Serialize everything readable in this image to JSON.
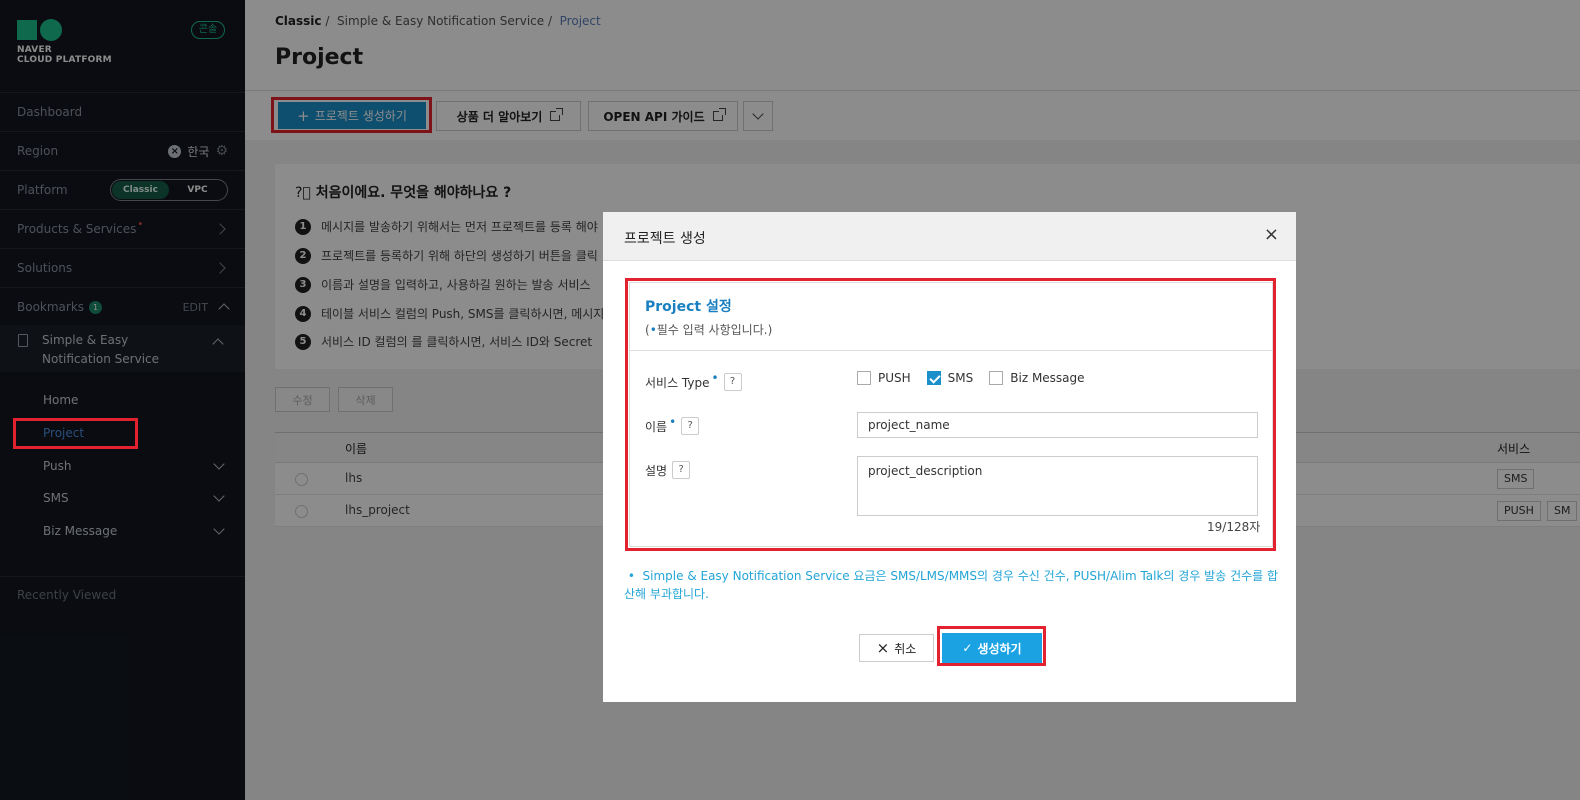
{
  "sidebar": {
    "logo_line1": "NAVER",
    "logo_line2": "CLOUD PLATFORM",
    "lang_badge": "콘솔",
    "dashboard": "Dashboard",
    "region_label": "Region",
    "region_value": "한국",
    "platform_label": "Platform",
    "platform_options": [
      "Classic",
      "VPC"
    ],
    "products": "Products & Services",
    "solutions": "Solutions",
    "bookmarks": "Bookmarks",
    "bookmarks_count": "1",
    "edit": "EDIT",
    "service_name": "Simple & Easy Notification Service",
    "sub_items": [
      "Home",
      "Project",
      "Push",
      "SMS",
      "Biz Message"
    ],
    "recently_viewed": "Recently Viewed"
  },
  "breadcrumb": {
    "root": "Classic",
    "service": "Simple & Easy Notification Service",
    "current": "Project",
    "sep": "/"
  },
  "page_title": "Project",
  "toolbar": {
    "create": "프로젝트 생성하기",
    "learn_more": "상품 더 알아보기",
    "api_guide": "OPEN API 가이드"
  },
  "guide": {
    "title": "처음이에요. 무엇을 해야하나요 ?",
    "steps": [
      "메시지를 발송하기 위해서는 먼저 프로젝트를 등록 해야",
      "프로젝트를 등록하기 위해 하단의 생성하기 버튼을 클릭",
      "이름과 설명을 입력하고, 사용하길 원하는 발송 서비스",
      "테이블 서비스 컬럼의 Push, SMS를 클릭하시면, 메시지",
      "서비스 ID 컬럼의 를 클릭하시면, 서비스 ID와 Secret"
    ]
  },
  "actions": {
    "edit": "수정",
    "delete": "삭제"
  },
  "table": {
    "headers": {
      "name": "이름",
      "service": "서비스"
    },
    "rows": [
      {
        "name": "lhs",
        "services": [
          "SMS"
        ]
      },
      {
        "name": "lhs_project",
        "services": [
          "PUSH",
          "SM"
        ]
      }
    ]
  },
  "modal": {
    "title": "프로젝트 생성",
    "close": "×",
    "section_title": "Project 설정",
    "required_note": "필수 입력 사항입니다.",
    "service_type_label": "서비스 Type",
    "service_types": [
      {
        "label": "PUSH",
        "checked": false
      },
      {
        "label": "SMS",
        "checked": true
      },
      {
        "label": "Biz Message",
        "checked": false
      }
    ],
    "name_label": "이름",
    "name_value": "project_name",
    "desc_label": "설명",
    "desc_value": "project_description",
    "counter": "19/128자",
    "notice": "Simple & Easy Notification Service 요금은 SMS/LMS/MMS의 경우 수신 건수, PUSH/Alim Talk의 경우 발송 건수를 합산해 부과합니다.",
    "cancel": "취소",
    "submit": "생성하기"
  },
  "colors": {
    "sidebar_bg": "#13171f",
    "accent": "#1a8fc9",
    "brand": "#1cc08a",
    "highlight": "#e3222f"
  }
}
